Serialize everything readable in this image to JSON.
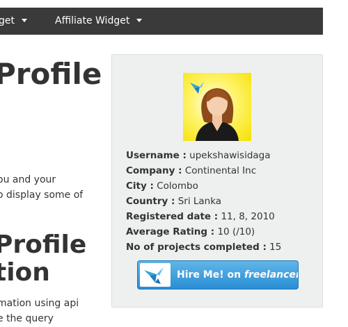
{
  "nav": {
    "items": [
      {
        "label": "get"
      },
      {
        "label": "Affiliate Widget"
      }
    ]
  },
  "main": {
    "heading1": "Profile",
    "para1": [
      "ou and your",
      "o display some of"
    ],
    "heading2": [
      "Profile",
      "tion"
    ],
    "para2": [
      "mation using api",
      "e the query"
    ]
  },
  "profile": {
    "username_label": "Username :",
    "username": "upekshawisidaga",
    "company_label": "Company :",
    "company": "Continental Inc",
    "city_label": "City :",
    "city": "Colombo",
    "country_label": "Country :",
    "country": "Sri Lanka",
    "registered_label": "Registered date :",
    "registered": "11, 8, 2010",
    "rating_label": "Average Rating :",
    "rating": "10 (/10)",
    "projects_label": "No of projects completed :",
    "projects": "15",
    "avatar_icon": "user-avatar-icon"
  },
  "hire_button": {
    "prefix": "Hire Me! on ",
    "brand": "freelancer",
    "icon": "bird-icon"
  },
  "colors": {
    "navbar": "#3a3a3a",
    "card_bg": "#eef0f0",
    "hire_button": "#2a8dd3",
    "avatar_bg": "#fff36a"
  }
}
